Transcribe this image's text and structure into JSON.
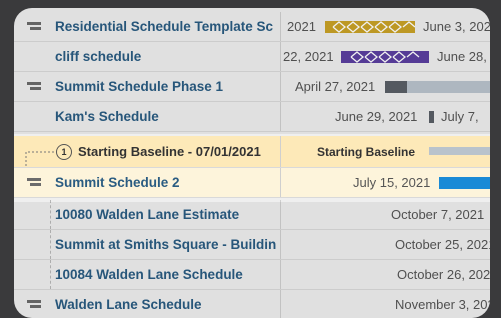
{
  "rows": [
    {
      "name": "Residential Schedule Template Sc",
      "date_left": "2021",
      "date_right": "June 3, 2021",
      "icon": "schedule-icon"
    },
    {
      "name": "cliff schedule",
      "date_left": "22, 2021",
      "date_right": "June 28, 2",
      "icon": ""
    },
    {
      "name": "Summit Schedule Phase 1",
      "date_left": "April 27, 2021",
      "icon": "schedule-icon"
    },
    {
      "name": "Kam's Schedule",
      "date_left": "June 29, 2021",
      "date_right": "July 7,",
      "icon": ""
    },
    {
      "name": "Starting Baseline - 07/01/2021",
      "badge": "1",
      "gantt_label": "Starting Baseline",
      "icon": ""
    },
    {
      "name": "Summit Schedule 2",
      "date_left": "July 15, 2021",
      "icon": "schedule-icon"
    },
    {
      "name": "10080 Walden Lane Estimate",
      "date_left": "October 7, 2021",
      "icon": ""
    },
    {
      "name": "Summit at Smiths Square - Buildin",
      "date_left": "October 25, 2021",
      "icon": ""
    },
    {
      "name": "10084 Walden Lane Schedule",
      "date_left": "October 26, 2021",
      "icon": ""
    },
    {
      "name": "Walden Lane Schedule",
      "date_left": "November 3, 2021",
      "icon": "schedule-icon"
    }
  ],
  "colors": {
    "name_text": "#2a5c82",
    "bar_gold": "#c9a227",
    "bar_purple": "#5b3fa0",
    "bar_gray": "#5a5f66",
    "bar_baseline": "#b9c3cc",
    "bar_blue": "#1a8ad6",
    "baseline_highlight": "#fde9b8"
  }
}
